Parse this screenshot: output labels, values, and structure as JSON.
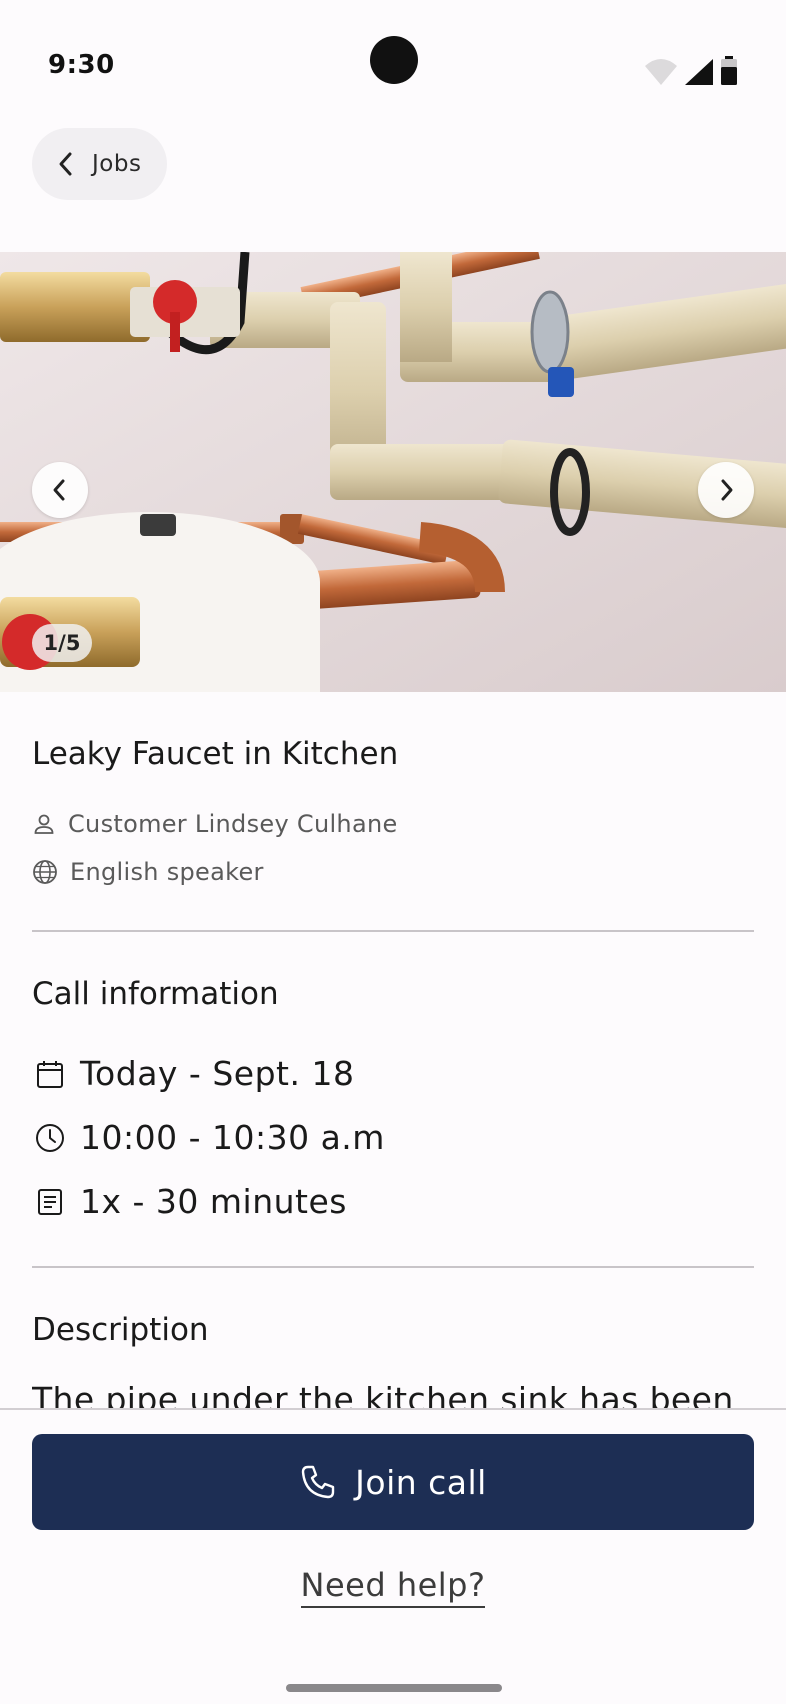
{
  "status_bar": {
    "time": "9:30",
    "icons": [
      "wifi-icon",
      "signal-icon",
      "battery-icon"
    ]
  },
  "header": {
    "back_label": "Jobs"
  },
  "carousel": {
    "counter": "1/5",
    "current": 1,
    "total": 5
  },
  "job": {
    "title": "Leaky Faucet in Kitchen",
    "customer": "Customer Lindsey Culhane",
    "language": "English speaker"
  },
  "call_info": {
    "title": "Call information",
    "date": "Today - Sept. 18",
    "time": "10:00 - 10:30 a.m",
    "duration": "1x - 30 minutes"
  },
  "description": {
    "title": "Description",
    "text": "The pipe under the kitchen sink has been"
  },
  "actions": {
    "join_label": "Join call",
    "help_label": "Need help?"
  },
  "colors": {
    "primary": "#1d2e54",
    "background": "#fdfbfd",
    "divider": "#c8c4c8"
  }
}
